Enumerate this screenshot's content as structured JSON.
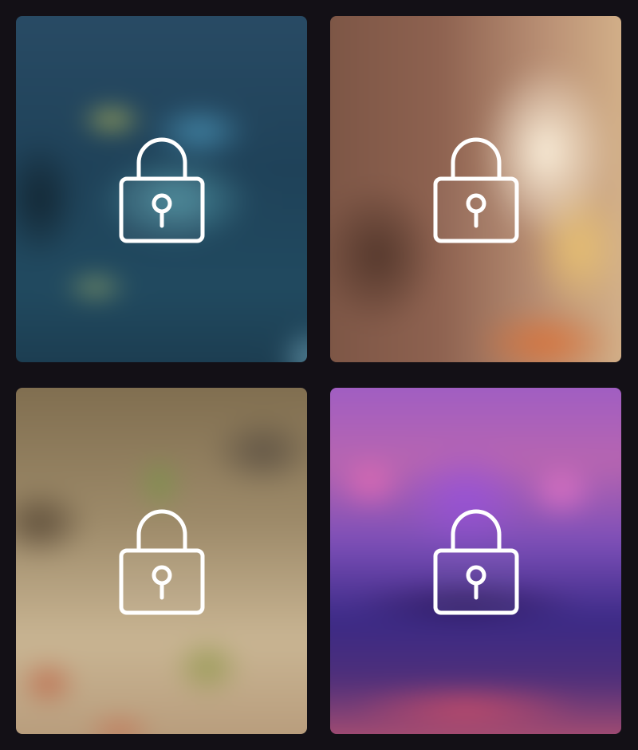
{
  "cards": [
    {
      "name": "locked-photo-1",
      "icon": "lock-icon",
      "locked": true,
      "tint": "#214a60"
    },
    {
      "name": "locked-photo-2",
      "icon": "lock-icon",
      "locked": true,
      "tint": "#b98f74"
    },
    {
      "name": "locked-photo-3",
      "icon": "lock-icon",
      "locked": true,
      "tint": "#9d8a69"
    },
    {
      "name": "locked-photo-4",
      "icon": "lock-icon",
      "locked": true,
      "tint": "#7d4fb8"
    }
  ],
  "colors": {
    "background": "#131016",
    "icon_stroke": "#ffffff"
  }
}
